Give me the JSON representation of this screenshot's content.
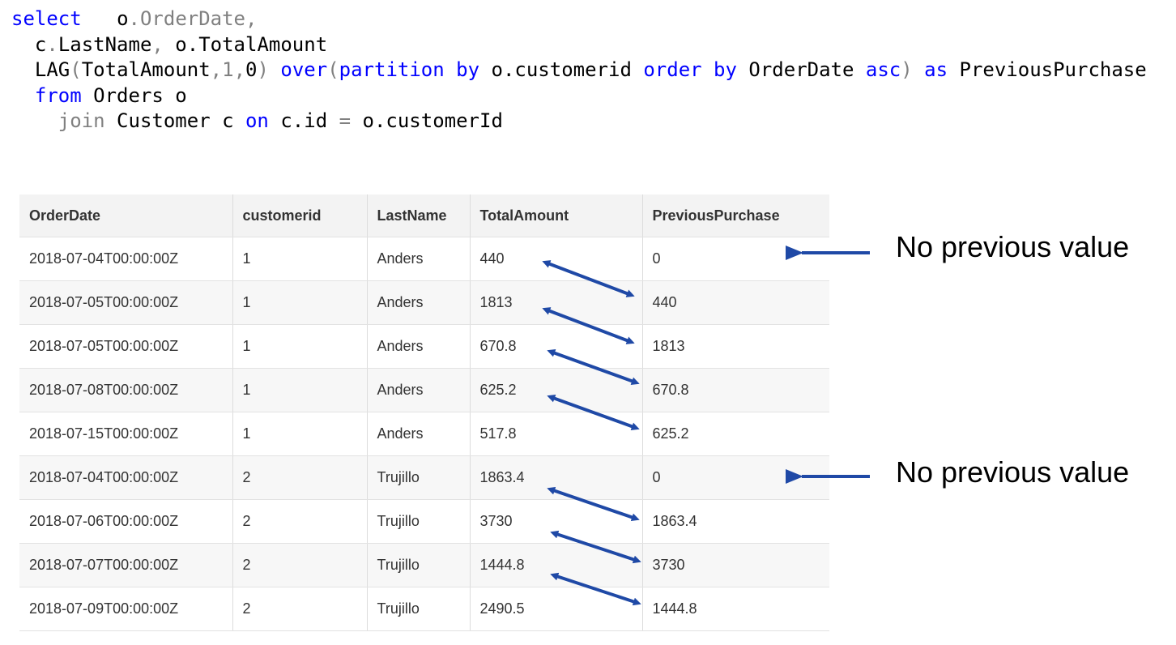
{
  "query": {
    "line1": {
      "kw": "select",
      "sp": "   ",
      "a": "o",
      "b": ".OrderDate,"
    },
    "line2": {
      "indent": "  ",
      "a": "c",
      "b": ".",
      "c": "LastName",
      "d": ",",
      "e": " o.TotalAmount"
    },
    "line3": {
      "indent": "  ",
      "fn": "LAG",
      "p1": "(",
      "arg": "TotalAmount",
      "p2": ",1,",
      "zero": "0",
      "p3": ")",
      "over": " over",
      "p4": "(",
      "partition": "partition",
      "by1": " by",
      "col": " o.customerid",
      "order": " order",
      "by2": " by",
      "od": " OrderDate",
      "asc": " asc",
      "p5": ")",
      "as": " as",
      "alias": " PreviousPurchase"
    },
    "line4": {
      "indent": "  ",
      "kw": "from",
      "rest": " Orders o"
    },
    "line5": {
      "indent": "    ",
      "kw": "join",
      "rest": " Customer c ",
      "on": "on",
      "cond": " c.id ",
      "eq": "=",
      "rest2": " o.customerId"
    }
  },
  "table": {
    "headers": [
      "OrderDate",
      "customerid",
      "LastName",
      "TotalAmount",
      "PreviousPurchase"
    ],
    "rows": [
      [
        "2018-07-04T00:00:00Z",
        "1",
        "Anders",
        "440",
        "0"
      ],
      [
        "2018-07-05T00:00:00Z",
        "1",
        "Anders",
        "1813",
        "440"
      ],
      [
        "2018-07-05T00:00:00Z",
        "1",
        "Anders",
        "670.8",
        "1813"
      ],
      [
        "2018-07-08T00:00:00Z",
        "1",
        "Anders",
        "625.2",
        "670.8"
      ],
      [
        "2018-07-15T00:00:00Z",
        "1",
        "Anders",
        "517.8",
        "625.2"
      ],
      [
        "2018-07-04T00:00:00Z",
        "2",
        "Trujillo",
        "1863.4",
        "0"
      ],
      [
        "2018-07-06T00:00:00Z",
        "2",
        "Trujillo",
        "3730",
        "1863.4"
      ],
      [
        "2018-07-07T00:00:00Z",
        "2",
        "Trujillo",
        "1444.8",
        "3730"
      ],
      [
        "2018-07-09T00:00:00Z",
        "2",
        "Trujillo",
        "2490.5",
        "1444.8"
      ]
    ]
  },
  "annotations": {
    "note_1": "No previous value",
    "note_2": "No previous value",
    "arrow_color": "#1f49a6"
  }
}
